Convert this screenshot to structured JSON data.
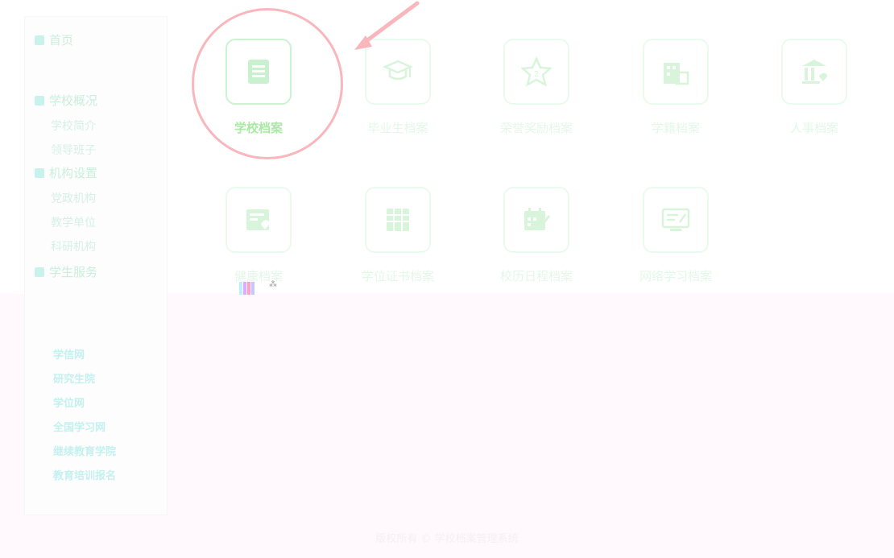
{
  "sidebar": {
    "sections": [
      {
        "label": "首页",
        "items": []
      },
      {
        "label": "学校概况",
        "items": [
          "学校简介",
          "领导班子"
        ]
      },
      {
        "label": "机构设置",
        "items": [
          "党政机构",
          "教学单位",
          "科研机构"
        ]
      },
      {
        "label": "学生服务",
        "items": []
      }
    ],
    "quick_links": [
      "学信网",
      "研究生院",
      "学位网",
      "全国学习网",
      "继续教育学院",
      "教育培训报名"
    ]
  },
  "main": {
    "tiles": [
      {
        "label": "学校档案",
        "icon": "book-icon",
        "active": true
      },
      {
        "label": "毕业生档案",
        "icon": "graduation-cap-icon",
        "active": false
      },
      {
        "label": "荣誉奖励档案",
        "icon": "star-icon",
        "active": false
      },
      {
        "label": "学籍档案",
        "icon": "building-icon",
        "active": false
      },
      {
        "label": "人事档案",
        "icon": "bank-icon",
        "active": false
      },
      {
        "label": "健康档案",
        "icon": "health-card-icon",
        "active": false
      },
      {
        "label": "学位证书档案",
        "icon": "table-icon",
        "active": false
      },
      {
        "label": "校历日程档案",
        "icon": "calendar-edit-icon",
        "active": false
      },
      {
        "label": "网络学习档案",
        "icon": "monitor-icon",
        "active": false
      }
    ]
  },
  "footer": {
    "text": "版权所有 © 学校档案管理系统"
  },
  "colors": {
    "icon": "#c9f0cf",
    "highlight": "#f9b7bd",
    "sidebar_text": "#cbeedd",
    "link_text": "#c4f1ef"
  }
}
